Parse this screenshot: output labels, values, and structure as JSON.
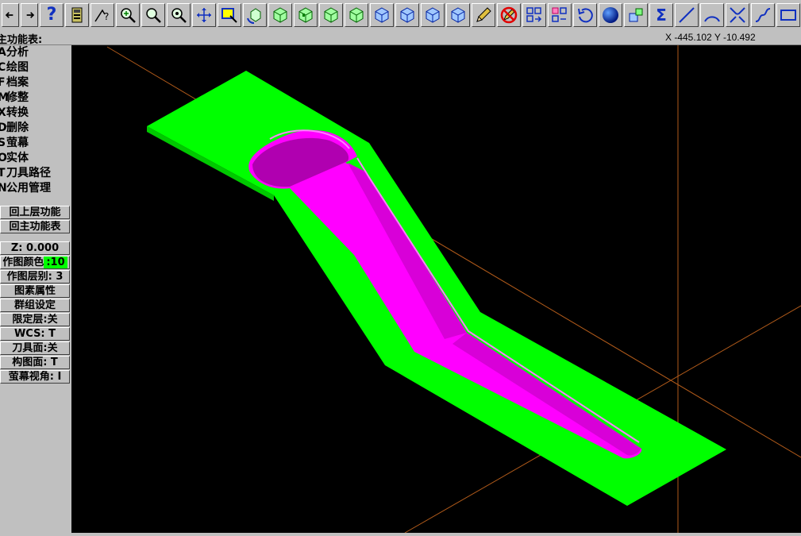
{
  "toolbar": {
    "buttons": [
      "back-arrow-icon",
      "forward-arrow-icon",
      "help-icon",
      "calculator-icon",
      "analyze-icon",
      "zoom-pan-icon",
      "zoom-icon",
      "zoom-out-icon",
      "move-icon",
      "select-box-icon",
      "rotate-view-icon",
      "cube-top-icon",
      "cube-front-icon",
      "cube-side-icon",
      "cube-iso-icon",
      "cube-blue-1-icon",
      "cube-blue-2-icon",
      "cube-blue-3-icon",
      "cube-blue-4-icon",
      "pencil-icon",
      "no-draw-icon",
      "copy-icon",
      "transform-icon",
      "undo-icon",
      "sphere-icon",
      "group-icon",
      "sum-icon",
      "line-icon",
      "arc-icon",
      "fillet-icon",
      "spline-icon",
      "rectangle-icon"
    ],
    "help_glyph": "?",
    "sum_glyph": "Σ"
  },
  "status": {
    "title": "主功能表:",
    "coords": "X -445.102   Y -10.492"
  },
  "menu": {
    "items": [
      "分析",
      "绘图",
      "档案",
      "修整",
      "转换",
      "删除",
      "萤幕",
      "实体",
      "刀具路径",
      "公用管理"
    ],
    "edges": [
      "A",
      "C",
      "F",
      "M",
      "X",
      "D",
      "S",
      "O",
      "T",
      "N"
    ]
  },
  "buttons": {
    "back": "回上层功能",
    "main": "回主功能表",
    "z": "Z:  0.000",
    "color_label": "作图颜色",
    "color_value": ":10",
    "layer": "作图层别: 3",
    "attributes": "图素属性",
    "group": "群组设定",
    "limit_layer": "限定层:关",
    "wcs": "WCS:  T",
    "tool_plane": "刀具面:关",
    "construction_plane": "构图面: T",
    "screen_view": "萤幕视角: I"
  },
  "colors": {
    "part": "#00ff00",
    "pocket": "#ff00ff",
    "axis": "#b05a1a",
    "background": "#000000"
  }
}
